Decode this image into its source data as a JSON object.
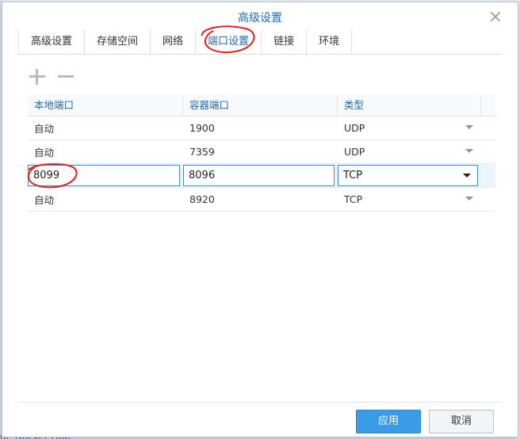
{
  "background": {
    "bottom_text": "dl: Docker Hub"
  },
  "dialog": {
    "title": "高级设置"
  },
  "tabs": [
    {
      "label": "高级设置"
    },
    {
      "label": "存储空间"
    },
    {
      "label": "网络"
    },
    {
      "label": "端口设置",
      "active": true
    },
    {
      "label": "链接"
    },
    {
      "label": "环境"
    }
  ],
  "grid": {
    "headers": [
      "本地端口",
      "容器端口",
      "类型"
    ],
    "rows": [
      {
        "local": "自动",
        "container": "1900",
        "type": "UDP"
      },
      {
        "local": "自动",
        "container": "7359",
        "type": "UDP"
      },
      {
        "local": "8099",
        "container": "8096",
        "type": "TCP"
      },
      {
        "local": "自动",
        "container": "8920",
        "type": "TCP"
      }
    ]
  },
  "buttons": {
    "apply": "应用",
    "cancel": "取消"
  },
  "colors": {
    "accent": "#1f6db5",
    "apply_button": "#3a9be6",
    "annotation": "#e02020"
  }
}
